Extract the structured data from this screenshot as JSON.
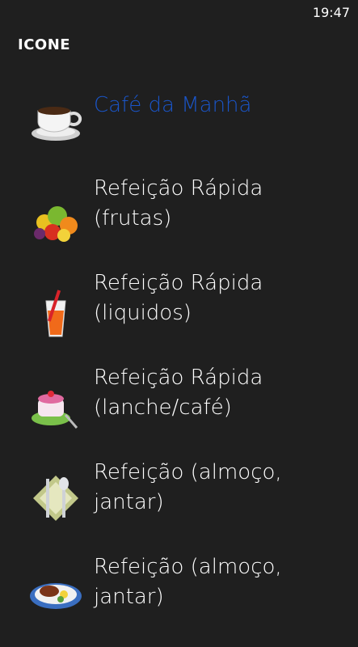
{
  "status": {
    "time": "19:47"
  },
  "header": {
    "title": "ICONE"
  },
  "items": [
    {
      "label": "Café da Manhã",
      "icon": "coffee-cup-icon",
      "selected": true
    },
    {
      "label": "Refeição Rápida\n(frutas)",
      "icon": "fruits-icon",
      "selected": false
    },
    {
      "label": "Refeição Rápida\n(liquidos)",
      "icon": "juice-glass-icon",
      "selected": false
    },
    {
      "label": "Refeição Rápida\n(lanche/café)",
      "icon": "cake-snack-icon",
      "selected": false
    },
    {
      "label": "Refeição (almoço,\njantar)",
      "icon": "cutlery-napkin-icon",
      "selected": false
    },
    {
      "label": "Refeição (almoço,\njantar)",
      "icon": "meal-plate-icon",
      "selected": false
    }
  ],
  "colors": {
    "background": "#1f1f1f",
    "accent": "#1a55c8",
    "text": "#ffffff"
  }
}
